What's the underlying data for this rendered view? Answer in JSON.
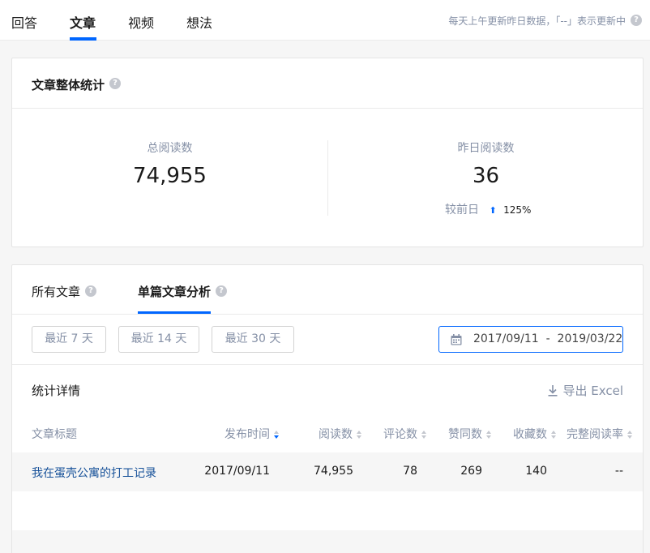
{
  "tabs": [
    "回答",
    "文章",
    "视频",
    "想法"
  ],
  "active_tab": "文章",
  "update_note": "每天上午更新昨日数据，「--」表示更新中",
  "overview": {
    "title": "文章整体统计",
    "total_reads_label": "总阅读数",
    "total_reads": "74,955",
    "yesterday_reads_label": "昨日阅读数",
    "yesterday_reads": "36",
    "compare_label": "较前日",
    "compare_value": "125%"
  },
  "analysis": {
    "tabs": [
      "所有文章",
      "单篇文章分析"
    ],
    "active_tab": "单篇文章分析",
    "ranges": [
      "最近 7 天",
      "最近 14 天",
      "最近 30 天"
    ],
    "date_range": "2017/09/11  -  2019/03/22",
    "detail_title": "统计详情",
    "export_label": "导出 Excel",
    "columns": [
      "文章标题",
      "发布时间",
      "阅读数",
      "评论数",
      "赞同数",
      "收藏数",
      "完整阅读率"
    ],
    "rows": [
      [
        "我在蛋壳公寓的打工记录",
        "2017/09/11",
        "74,955",
        "78",
        "269",
        "140",
        "--"
      ]
    ]
  },
  "colors": {
    "accent": "#0066ff",
    "link": "#175199",
    "muted": "#8590a6"
  },
  "icons": [
    "question-icon",
    "arrow-up-icon",
    "calendar-icon",
    "download-icon",
    "sort-icon"
  ]
}
